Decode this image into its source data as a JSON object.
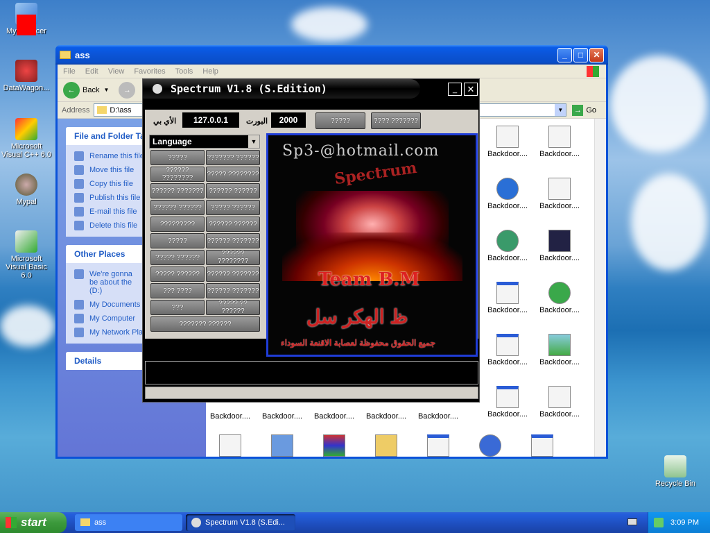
{
  "desktop": {
    "icons": [
      {
        "label": "My Computer",
        "partial_label": "My",
        "hidden_label": "cer"
      },
      {
        "label": "DataWagon..."
      },
      {
        "label": "Microsoft Visual C++ 6.0"
      },
      {
        "label": "Mypal"
      },
      {
        "label": "Microsoft Visual Basic 6.0"
      },
      {
        "label": "Recycle Bin"
      }
    ]
  },
  "explorer": {
    "title": "ass",
    "menu": [
      "File",
      "Edit",
      "View",
      "Favorites",
      "Tools",
      "Help"
    ],
    "back_label": "Back",
    "address_label": "Address",
    "address_value": "D:\\ass",
    "go_label": "Go",
    "file_tasks": {
      "title": "File and Folder Ta",
      "items": [
        "Rename this file",
        "Move this file",
        "Copy this file",
        "Publish this file",
        "E-mail this file",
        "Delete this file"
      ]
    },
    "other_places": {
      "title": "Other Places",
      "items": [
        "We're gonna be about the (D:)",
        "My Documents",
        "My Computer",
        "My Network Pla"
      ]
    },
    "details": {
      "title": "Details"
    },
    "files": [
      "Backdoor....",
      "Backdoor....",
      "Backdoor....",
      "Backdoor....",
      "Backdoor....",
      "Backdoor....",
      "Backdoor....",
      "Backdoor....",
      "Backdoor....",
      "Backdoor....",
      "Backdoor....",
      "Backdoor....",
      "Backdoor....",
      "Backdoor....",
      "Backdoor....",
      "Backdoor....",
      "Backdoor...."
    ]
  },
  "spectrum": {
    "title": "Spectrum V1.8 (S.Edition)",
    "ip_label": "الأي بي",
    "ip_value": "127.0.0.1",
    "port_label": "البورت",
    "port_value": "2000",
    "btn_connect": "?????",
    "btn_disconnect": "???? ???????",
    "language": "Language",
    "buttons": [
      [
        "?????",
        "??????? ??????"
      ],
      [
        "?????? ????????",
        "????? ????????"
      ],
      [
        "?????? ???????",
        "?????? ??????"
      ],
      [
        "?????? ??????",
        "????? ??????"
      ],
      [
        "?????????",
        "?????? ??????"
      ],
      [
        "?????",
        "?????? ???????"
      ],
      [
        "????? ??????",
        "?????? ????????"
      ],
      [
        "????? ??????",
        "?????? ???????"
      ],
      [
        "??? ????",
        "?????? ???????"
      ],
      [
        "???",
        "????? ?? ??????"
      ]
    ],
    "wide_button": "??????? ??????",
    "poster": {
      "email": "Sp3-@hotmail.com",
      "brand": "Spectrum",
      "team": "Team B.M",
      "arabic_name": "ظ الهكر سل",
      "rights": "جميع الحقوق محفوظة لعصابة الاقنعة السوداء"
    }
  },
  "taskbar": {
    "start_label": "start",
    "tasks": [
      "ass",
      "Spectrum V1.8 (S.Edi..."
    ],
    "clock": "3:09 PM"
  }
}
